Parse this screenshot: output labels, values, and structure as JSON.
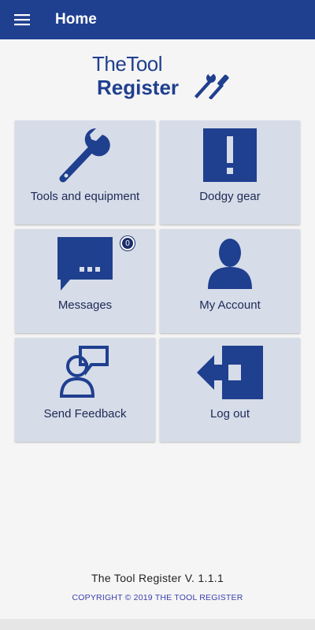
{
  "appbar": {
    "title": "Home",
    "menu_icon": "hamburger-menu-icon"
  },
  "logo": {
    "line1_the": "The",
    "line1_tool": "Tool",
    "line2": "Register",
    "icon": "wrench-screwdriver-icon"
  },
  "tiles": [
    {
      "label": "Tools and equipment",
      "icon": "wrench-icon"
    },
    {
      "label": "Dodgy gear",
      "icon": "exclamation-icon"
    },
    {
      "label": "Messages",
      "icon": "message-bubble-icon",
      "badge": "0"
    },
    {
      "label": "My Account",
      "icon": "person-icon"
    },
    {
      "label": "Send Feedback",
      "icon": "person-speech-icon"
    },
    {
      "label": "Log out",
      "icon": "logout-arrow-icon"
    }
  ],
  "footer": {
    "version": "The Tool Register V. 1.1.1",
    "copyright": "COPYRIGHT © 2019 THE TOOL REGISTER"
  },
  "colors": {
    "primary": "#1f3f8f",
    "tile_bg": "#d6dce8",
    "copyright": "#3a3fae"
  }
}
